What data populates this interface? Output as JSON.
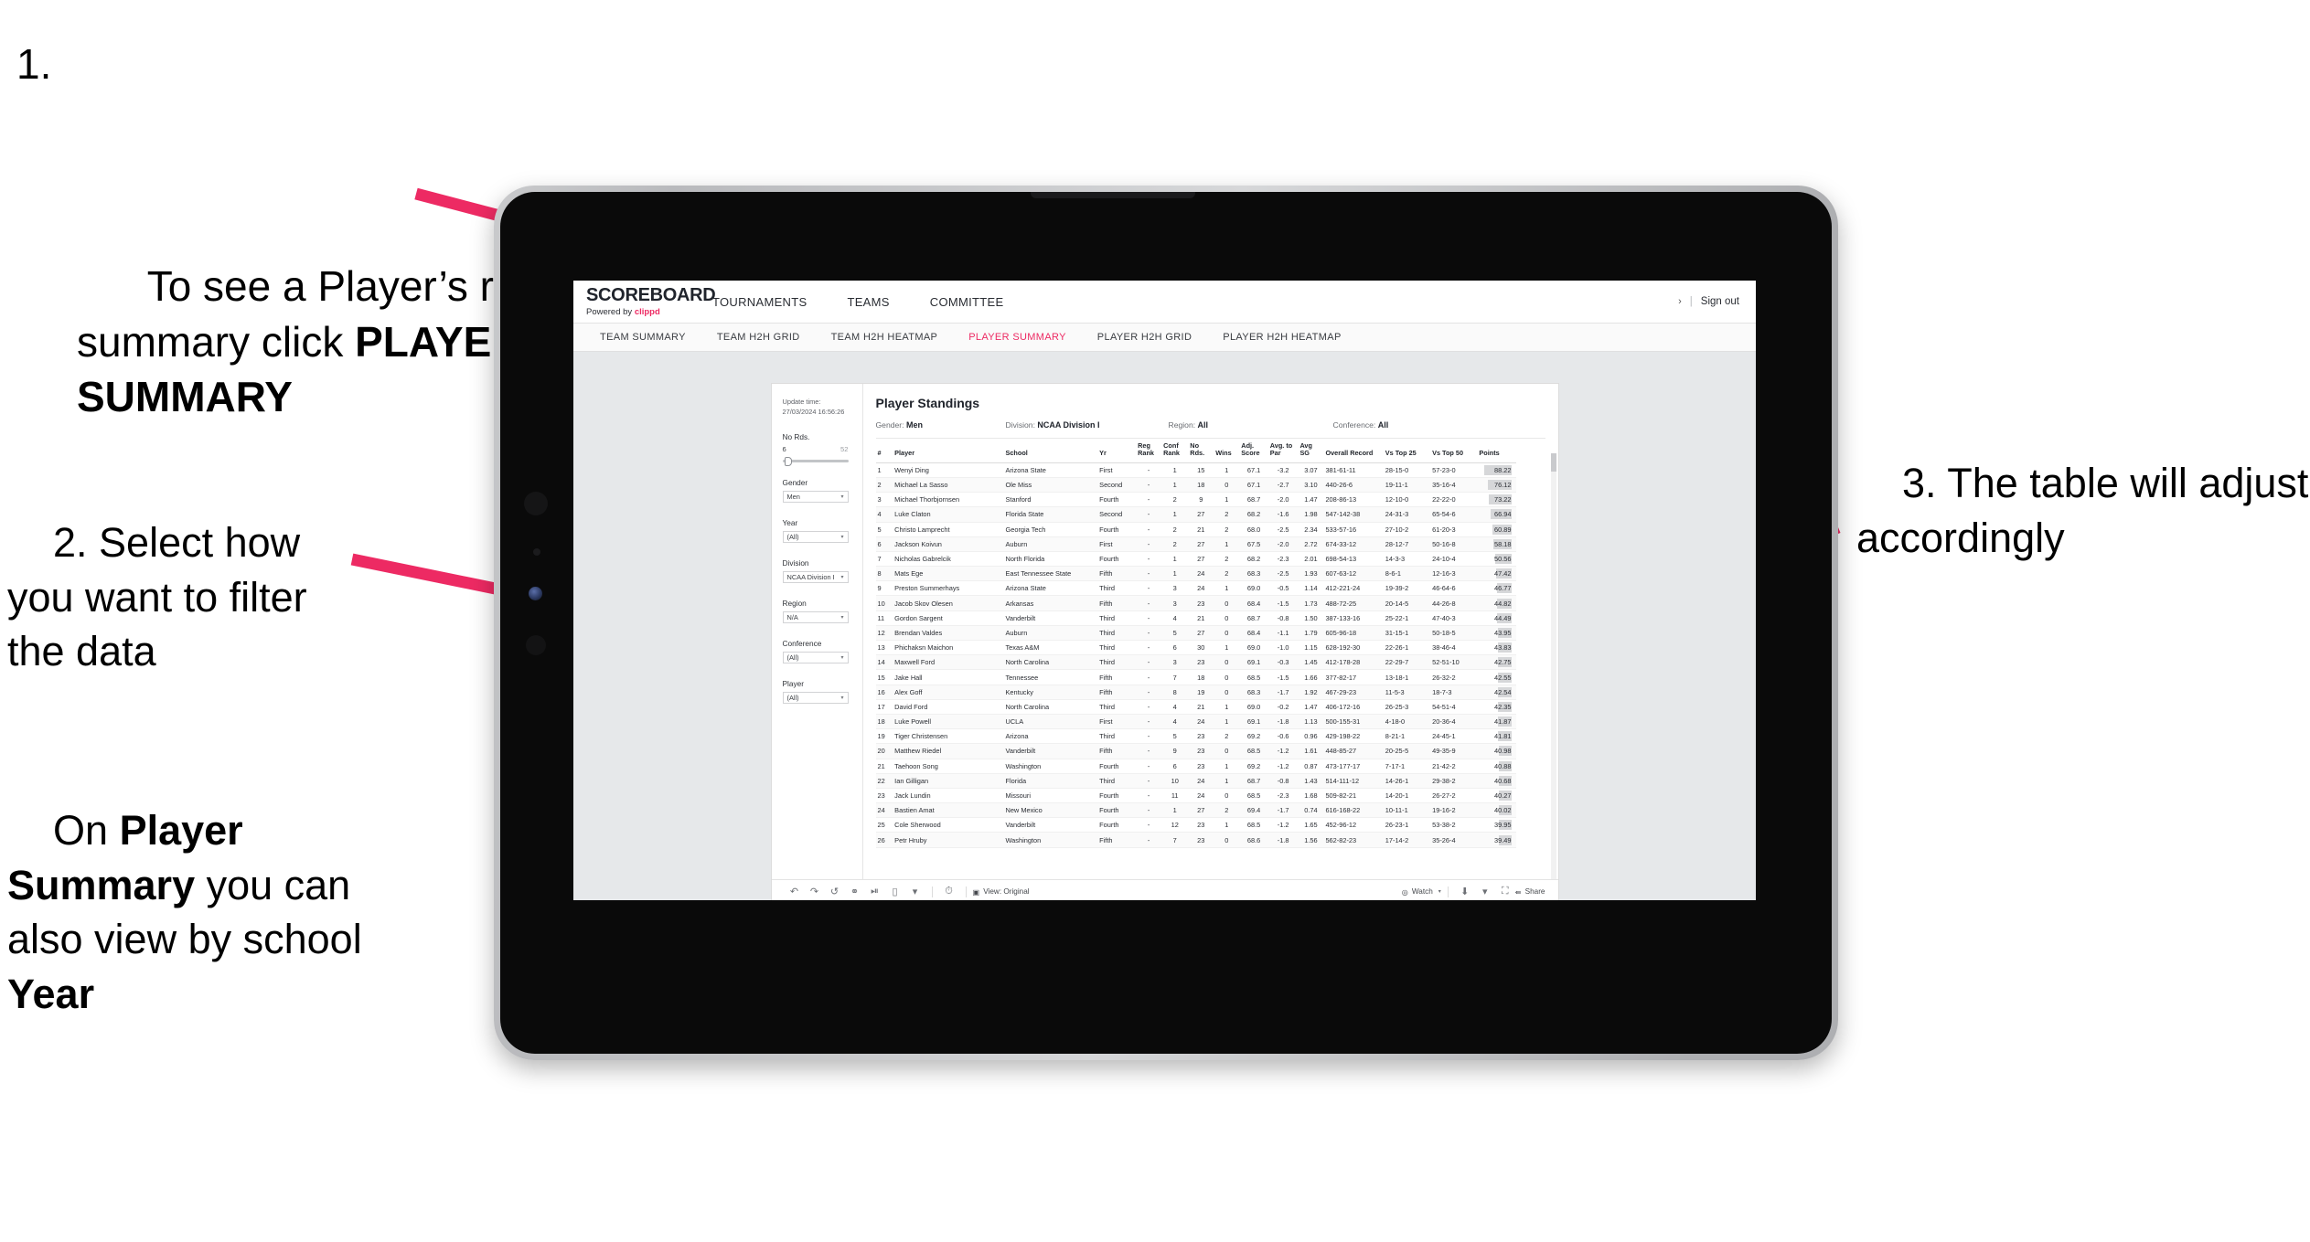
{
  "annotations": {
    "step1_number": "1.",
    "step1_text_a": "To see a Player’s rankings summary click ",
    "step1_bold": "PLAYER SUMMARY",
    "step2_a": "2. Select how you want to filter the data",
    "step3_pre": "On ",
    "step3_b1": "Player Summary",
    "step3_mid": " you can also view by school ",
    "step3_b2": "Year",
    "step4": "3. The table will adjust accordingly",
    "arrow_color": "#ed2a63"
  },
  "app": {
    "logo_title": "SCOREBOARD",
    "logo_sub_prefix": "Powered by ",
    "logo_sub_brand": "clippd",
    "top_nav": [
      "TOURNAMENTS",
      "TEAMS",
      "COMMITTEE"
    ],
    "signout_chevron": "›",
    "signout_sep": "|",
    "signout_label": "Sign out",
    "sub_nav": [
      {
        "label": "TEAM SUMMARY",
        "active": false
      },
      {
        "label": "TEAM H2H GRID",
        "active": false
      },
      {
        "label": "TEAM H2H HEATMAP",
        "active": false
      },
      {
        "label": "PLAYER SUMMARY",
        "active": true
      },
      {
        "label": "PLAYER H2H GRID",
        "active": false
      },
      {
        "label": "PLAYER H2H HEATMAP",
        "active": false
      }
    ],
    "accent_color": "#ed2a63"
  },
  "filters": {
    "update_time_label": "Update time:",
    "update_time_value": "27/03/2024 16:56:26",
    "no_rds": {
      "label": "No Rds.",
      "min": "6",
      "max": "52"
    },
    "groups": [
      {
        "label": "Gender",
        "value": "Men"
      },
      {
        "label": "Year",
        "value": "(All)"
      },
      {
        "label": "Division",
        "value": "NCAA Division I"
      },
      {
        "label": "Region",
        "value": "N/A"
      },
      {
        "label": "Conference",
        "value": "(All)"
      },
      {
        "label": "Player",
        "value": "(All)"
      }
    ]
  },
  "panel": {
    "title": "Player Standings",
    "meta": [
      {
        "label": "Gender: ",
        "value": "Men"
      },
      {
        "label": "Division: ",
        "value": "NCAA Division I"
      },
      {
        "label": "Region: ",
        "value": "All"
      },
      {
        "label": "Conference: ",
        "value": "All"
      }
    ]
  },
  "table": {
    "columns": [
      "#",
      "Player",
      "School",
      "Yr",
      "Reg Rank",
      "Conf Rank",
      "No Rds.",
      "Wins",
      "Adj. Score",
      "Avg. to Par",
      "Avg SG",
      "Overall Record",
      "Vs Top 25",
      "Vs Top 50",
      "Points"
    ],
    "rows": [
      [
        "1",
        "Wenyi Ding",
        "Arizona State",
        "First",
        "-",
        "1",
        "15",
        "1",
        "67.1",
        "-3.2",
        "3.07",
        "381-61-11",
        "28-15-0",
        "57-23-0",
        "88.22"
      ],
      [
        "2",
        "Michael La Sasso",
        "Ole Miss",
        "Second",
        "-",
        "1",
        "18",
        "0",
        "67.1",
        "-2.7",
        "3.10",
        "440-26-6",
        "19-11-1",
        "35-16-4",
        "76.12"
      ],
      [
        "3",
        "Michael Thorbjornsen",
        "Stanford",
        "Fourth",
        "-",
        "2",
        "9",
        "1",
        "68.7",
        "-2.0",
        "1.47",
        "208-86-13",
        "12-10-0",
        "22-22-0",
        "73.22"
      ],
      [
        "4",
        "Luke Claton",
        "Florida State",
        "Second",
        "-",
        "1",
        "27",
        "2",
        "68.2",
        "-1.6",
        "1.98",
        "547-142-38",
        "24-31-3",
        "65-54-6",
        "66.94"
      ],
      [
        "5",
        "Christo Lamprecht",
        "Georgia Tech",
        "Fourth",
        "-",
        "2",
        "21",
        "2",
        "68.0",
        "-2.5",
        "2.34",
        "533-57-16",
        "27-10-2",
        "61-20-3",
        "60.89"
      ],
      [
        "6",
        "Jackson Koivun",
        "Auburn",
        "First",
        "-",
        "2",
        "27",
        "1",
        "67.5",
        "-2.0",
        "2.72",
        "674-33-12",
        "28-12-7",
        "50-16-8",
        "58.18"
      ],
      [
        "7",
        "Nicholas Gabrelcik",
        "North Florida",
        "Fourth",
        "-",
        "1",
        "27",
        "2",
        "68.2",
        "-2.3",
        "2.01",
        "698-54-13",
        "14-3-3",
        "24-10-4",
        "50.56"
      ],
      [
        "8",
        "Mats Ege",
        "East Tennessee State",
        "Fifth",
        "-",
        "1",
        "24",
        "2",
        "68.3",
        "-2.5",
        "1.93",
        "607-63-12",
        "8-6-1",
        "12-16-3",
        "47.42"
      ],
      [
        "9",
        "Preston Summerhays",
        "Arizona State",
        "Third",
        "-",
        "3",
        "24",
        "1",
        "69.0",
        "-0.5",
        "1.14",
        "412-221-24",
        "19-39-2",
        "46-64-6",
        "46.77"
      ],
      [
        "10",
        "Jacob Skov Olesen",
        "Arkansas",
        "Fifth",
        "-",
        "3",
        "23",
        "0",
        "68.4",
        "-1.5",
        "1.73",
        "488-72-25",
        "20-14-5",
        "44-26-8",
        "44.82"
      ],
      [
        "11",
        "Gordon Sargent",
        "Vanderbilt",
        "Third",
        "-",
        "4",
        "21",
        "0",
        "68.7",
        "-0.8",
        "1.50",
        "387-133-16",
        "25-22-1",
        "47-40-3",
        "44.49"
      ],
      [
        "12",
        "Brendan Valdes",
        "Auburn",
        "Third",
        "-",
        "5",
        "27",
        "0",
        "68.4",
        "-1.1",
        "1.79",
        "605-96-18",
        "31-15-1",
        "50-18-5",
        "43.95"
      ],
      [
        "13",
        "Phichaksn Maichon",
        "Texas A&M",
        "Third",
        "-",
        "6",
        "30",
        "1",
        "69.0",
        "-1.0",
        "1.15",
        "628-192-30",
        "22-26-1",
        "38-46-4",
        "43.83"
      ],
      [
        "14",
        "Maxwell Ford",
        "North Carolina",
        "Third",
        "-",
        "3",
        "23",
        "0",
        "69.1",
        "-0.3",
        "1.45",
        "412-178-28",
        "22-29-7",
        "52-51-10",
        "42.75"
      ],
      [
        "15",
        "Jake Hall",
        "Tennessee",
        "Fifth",
        "-",
        "7",
        "18",
        "0",
        "68.5",
        "-1.5",
        "1.66",
        "377-82-17",
        "13-18-1",
        "26-32-2",
        "42.55"
      ],
      [
        "16",
        "Alex Goff",
        "Kentucky",
        "Fifth",
        "-",
        "8",
        "19",
        "0",
        "68.3",
        "-1.7",
        "1.92",
        "467-29-23",
        "11-5-3",
        "18-7-3",
        "42.54"
      ],
      [
        "17",
        "David Ford",
        "North Carolina",
        "Third",
        "-",
        "4",
        "21",
        "1",
        "69.0",
        "-0.2",
        "1.47",
        "406-172-16",
        "26-25-3",
        "54-51-4",
        "42.35"
      ],
      [
        "18",
        "Luke Powell",
        "UCLA",
        "First",
        "-",
        "4",
        "24",
        "1",
        "69.1",
        "-1.8",
        "1.13",
        "500-155-31",
        "4-18-0",
        "20-36-4",
        "41.87"
      ],
      [
        "19",
        "Tiger Christensen",
        "Arizona",
        "Third",
        "-",
        "5",
        "23",
        "2",
        "69.2",
        "-0.6",
        "0.96",
        "429-198-22",
        "8-21-1",
        "24-45-1",
        "41.81"
      ],
      [
        "20",
        "Matthew Riedel",
        "Vanderbilt",
        "Fifth",
        "-",
        "9",
        "23",
        "0",
        "68.5",
        "-1.2",
        "1.61",
        "448-85-27",
        "20-25-5",
        "49-35-9",
        "40.98"
      ],
      [
        "21",
        "Taehoon Song",
        "Washington",
        "Fourth",
        "-",
        "6",
        "23",
        "1",
        "69.2",
        "-1.2",
        "0.87",
        "473-177-17",
        "7-17-1",
        "21-42-2",
        "40.88"
      ],
      [
        "22",
        "Ian Gilligan",
        "Florida",
        "Third",
        "-",
        "10",
        "24",
        "1",
        "68.7",
        "-0.8",
        "1.43",
        "514-111-12",
        "14-26-1",
        "29-38-2",
        "40.68"
      ],
      [
        "23",
        "Jack Lundin",
        "Missouri",
        "Fourth",
        "-",
        "11",
        "24",
        "0",
        "68.5",
        "-2.3",
        "1.68",
        "509-82-21",
        "14-20-1",
        "26-27-2",
        "40.27"
      ],
      [
        "24",
        "Bastien Amat",
        "New Mexico",
        "Fourth",
        "-",
        "1",
        "27",
        "2",
        "69.4",
        "-1.7",
        "0.74",
        "616-168-22",
        "10-11-1",
        "19-16-2",
        "40.02"
      ],
      [
        "25",
        "Cole Sherwood",
        "Vanderbilt",
        "Fourth",
        "-",
        "12",
        "23",
        "1",
        "68.5",
        "-1.2",
        "1.65",
        "452-96-12",
        "26-23-1",
        "53-38-2",
        "39.95"
      ],
      [
        "26",
        "Petr Hruby",
        "Washington",
        "Fifth",
        "-",
        "7",
        "23",
        "0",
        "68.6",
        "-1.8",
        "1.56",
        "562-82-23",
        "17-14-2",
        "35-26-4",
        "39.49"
      ]
    ],
    "points_max": 88.22
  },
  "toolbar": {
    "left_icons": [
      "undo-icon",
      "redo-icon",
      "revert-icon",
      "refresh-icon",
      "pause-icon",
      "flow-icon"
    ],
    "flow_caret": "▾",
    "clock_icon": "clock-icon",
    "view_label": "View: Original",
    "watch_label": "Watch",
    "watch_caret": "▾",
    "download_caret": "▾",
    "share_label": "Share"
  }
}
